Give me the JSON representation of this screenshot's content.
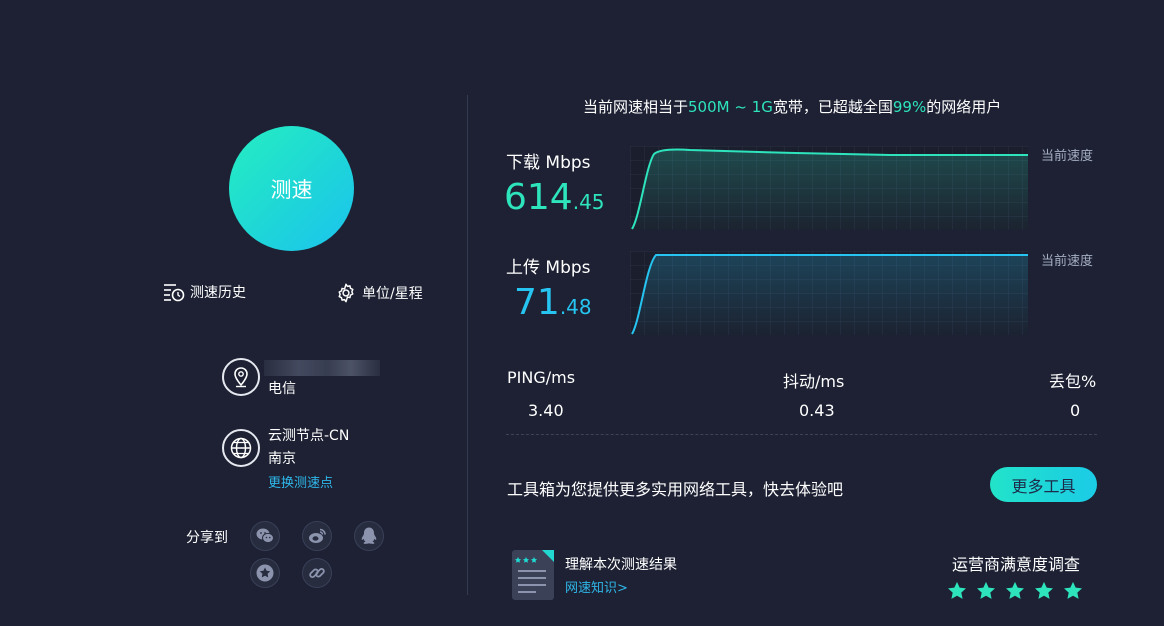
{
  "left": {
    "speed_button": "测速",
    "history_label": "测速历史",
    "units_label": "单位/星程",
    "isp": "电信",
    "node_name": "云测节点-CN",
    "node_city": "南京",
    "change_node": "更换测速点",
    "share_label": "分享到",
    "share_icons": [
      "wechat-icon",
      "weibo-icon",
      "qq-icon",
      "favorite-icon",
      "link-icon"
    ]
  },
  "headline": {
    "prefix": "当前网速相当于",
    "range": "500M ~ 1G",
    "middle": "宽带，已超越全国",
    "percent": "99%",
    "suffix": "的网络用户"
  },
  "download": {
    "label": "下载 Mbps",
    "int": "614",
    "dec": ".45",
    "current_label": "当前速度",
    "color": "#2ee4bd"
  },
  "upload": {
    "label": "上传 Mbps",
    "int": "71",
    "dec": ".48",
    "current_label": "当前速度",
    "color": "#26c4f0"
  },
  "stats": {
    "ping_label": "PING/ms",
    "ping_value": "3.40",
    "jitter_label": "抖动/ms",
    "jitter_value": "0.43",
    "loss_label": "丢包%",
    "loss_value": "0"
  },
  "toolbox": {
    "text": "工具箱为您提供更多实用网络工具，快去体验吧",
    "button": "更多工具"
  },
  "knowledge": {
    "title": "理解本次测速结果",
    "link": "网速知识>"
  },
  "survey": {
    "title": "运营商满意度调查",
    "stars": 5
  }
}
